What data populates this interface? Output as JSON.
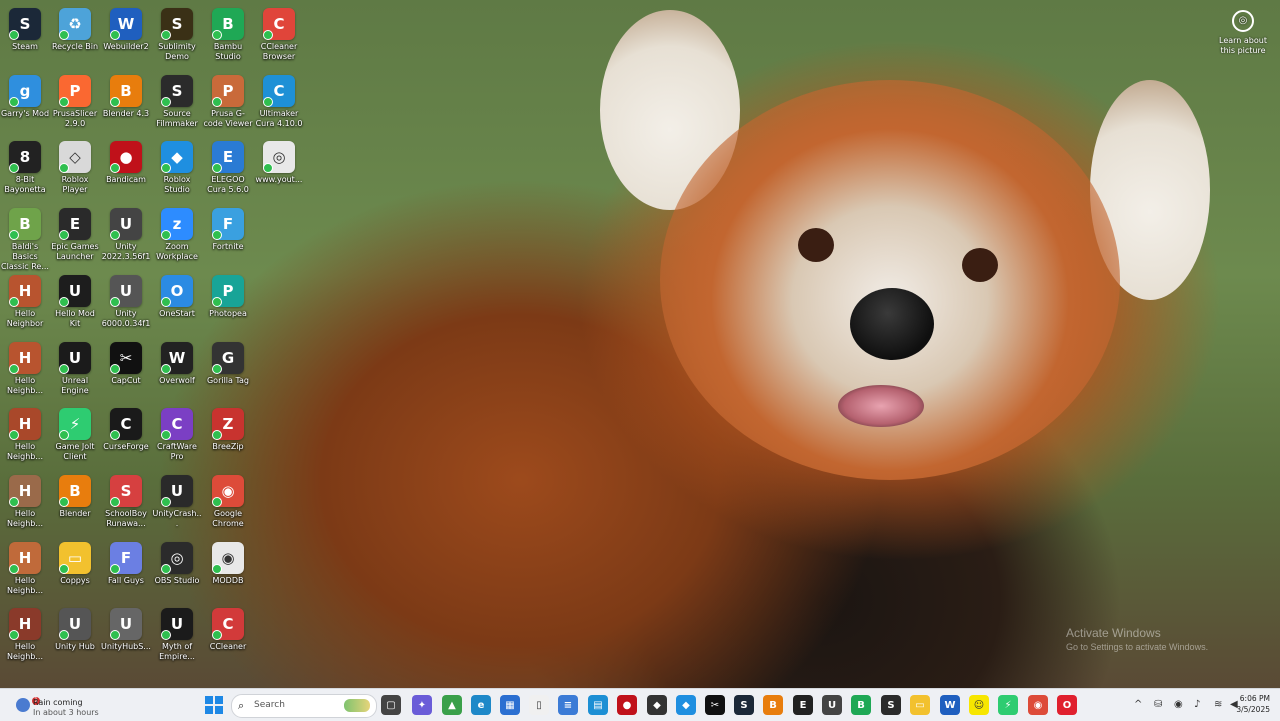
{
  "desktop": {
    "learn_more_label": "Learn about this picture",
    "watermark": {
      "line1": "Activate Windows",
      "line2": "Go to Settings to activate Windows."
    },
    "icons": [
      {
        "label": "Steam",
        "color": "#1b2838",
        "glyph": "S"
      },
      {
        "label": "Recycle Bin",
        "color": "#4da3d9",
        "glyph": "♻"
      },
      {
        "label": "Webuilder2",
        "color": "#1f5fbf",
        "glyph": "W"
      },
      {
        "label": "Sublimity Demo",
        "color": "#3a3016",
        "glyph": "S"
      },
      {
        "label": "Bambu Studio",
        "color": "#1fa855",
        "glyph": "B"
      },
      {
        "label": "CCleaner Browser",
        "color": "#e0453a",
        "glyph": "C"
      },
      {
        "label": "Garry's Mod",
        "color": "#2f8fde",
        "glyph": "g"
      },
      {
        "label": "PrusaSlicer 2.9.0",
        "color": "#fa6831",
        "glyph": "P"
      },
      {
        "label": "Blender 4.3",
        "color": "#e87d0d",
        "glyph": "B"
      },
      {
        "label": "Source Filmmaker",
        "color": "#2b2b2b",
        "glyph": "S"
      },
      {
        "label": "Prusa G-code Viewer",
        "color": "#c96a3a",
        "glyph": "P"
      },
      {
        "label": "Ultimaker Cura 4.10.0",
        "color": "#1e90d6",
        "glyph": "C"
      },
      {
        "label": "8-Bit Bayonetta",
        "color": "#222222",
        "glyph": "8"
      },
      {
        "label": "Roblox Player",
        "color": "#d9d9d9",
        "glyph": "◇"
      },
      {
        "label": "Bandicam",
        "color": "#c0111a",
        "glyph": "●"
      },
      {
        "label": "Roblox Studio",
        "color": "#1f8fe0",
        "glyph": "◆"
      },
      {
        "label": "ELEGOO Cura 5.6.0",
        "color": "#2a7bd4",
        "glyph": "E"
      },
      {
        "label": "www.yout...",
        "color": "#e8e8e8",
        "glyph": "◎"
      },
      {
        "label": "Baldi's Basics Classic Re...",
        "color": "#6fa34a",
        "glyph": "B"
      },
      {
        "label": "Epic Games Launcher",
        "color": "#2a2a2a",
        "glyph": "E"
      },
      {
        "label": "Unity 2022.3.56f1",
        "color": "#444444",
        "glyph": "U"
      },
      {
        "label": "Zoom Workplace",
        "color": "#2d8cff",
        "glyph": "z"
      },
      {
        "label": "Fortnite",
        "color": "#3aa0e0",
        "glyph": "F"
      },
      {
        "label": "",
        "color": "",
        "glyph": ""
      },
      {
        "label": "Hello Neighbor",
        "color": "#b8542f",
        "glyph": "H"
      },
      {
        "label": "Hello Mod Kit",
        "color": "#1d1d1d",
        "glyph": "U"
      },
      {
        "label": "Unity 6000.0.34f1",
        "color": "#555555",
        "glyph": "U"
      },
      {
        "label": "OneStart",
        "color": "#2b8be3",
        "glyph": "O"
      },
      {
        "label": "Photopea",
        "color": "#18a497",
        "glyph": "P"
      },
      {
        "label": "",
        "color": "",
        "glyph": ""
      },
      {
        "label": "Hello Neighb...",
        "color": "#b8542f",
        "glyph": "H"
      },
      {
        "label": "Unreal Engine",
        "color": "#1b1b1b",
        "glyph": "U"
      },
      {
        "label": "CapCut",
        "color": "#111111",
        "glyph": "✂"
      },
      {
        "label": "Overwolf",
        "color": "#222222",
        "glyph": "W"
      },
      {
        "label": "Gorilla Tag",
        "color": "#333333",
        "glyph": "G"
      },
      {
        "label": "",
        "color": "",
        "glyph": ""
      },
      {
        "label": "Hello Neighb...",
        "color": "#a9482a",
        "glyph": "H"
      },
      {
        "label": "Game Jolt Client",
        "color": "#2ecc71",
        "glyph": "⚡"
      },
      {
        "label": "CurseForge",
        "color": "#1a1a1a",
        "glyph": "C"
      },
      {
        "label": "CraftWare Pro",
        "color": "#7b3fc4",
        "glyph": "C"
      },
      {
        "label": "BreeZip",
        "color": "#c8332f",
        "glyph": "Z"
      },
      {
        "label": "",
        "color": "",
        "glyph": ""
      },
      {
        "label": "Hello Neighb...",
        "color": "#9a6a4a",
        "glyph": "H"
      },
      {
        "label": "Blender",
        "color": "#e87d0d",
        "glyph": "B"
      },
      {
        "label": "SchoolBoy Runawa...",
        "color": "#d64040",
        "glyph": "S"
      },
      {
        "label": "UnityCrash...",
        "color": "#2a2a2a",
        "glyph": "U"
      },
      {
        "label": "Google Chrome",
        "color": "#dd4b39",
        "glyph": "◉"
      },
      {
        "label": "",
        "color": "",
        "glyph": ""
      },
      {
        "label": "Hello Neighb...",
        "color": "#c06a3a",
        "glyph": "H"
      },
      {
        "label": "Coppys",
        "color": "#f2c12e",
        "glyph": "▭"
      },
      {
        "label": "Fall Guys",
        "color": "#6b7fe3",
        "glyph": "F"
      },
      {
        "label": "OBS Studio",
        "color": "#2b2b2b",
        "glyph": "◎"
      },
      {
        "label": "MODDB",
        "color": "#e8e8e8",
        "glyph": "◉"
      },
      {
        "label": "",
        "color": "",
        "glyph": ""
      },
      {
        "label": "Hello Neighb...",
        "color": "#8a3a2a",
        "glyph": "H"
      },
      {
        "label": "Unity Hub",
        "color": "#555555",
        "glyph": "U"
      },
      {
        "label": "UnityHubS...",
        "color": "#666666",
        "glyph": "U"
      },
      {
        "label": "Myth of Empire...",
        "color": "#1b1b1b",
        "glyph": "U"
      },
      {
        "label": "CCleaner",
        "color": "#d23a3a",
        "glyph": "C"
      },
      {
        "label": "",
        "color": "",
        "glyph": ""
      }
    ]
  },
  "taskbar": {
    "weather_line1": "Rain coming",
    "weather_line2": "In about 3 hours",
    "weather_badge": "1",
    "search_placeholder": "Search",
    "pinned": [
      {
        "name": "task-view",
        "color": "#444444",
        "glyph": "▢"
      },
      {
        "name": "copilot",
        "color": "#6a5cd8",
        "glyph": "✦"
      },
      {
        "name": "game-app",
        "color": "#3aa04a",
        "glyph": "▲"
      },
      {
        "name": "edge",
        "color": "#1e88c8",
        "glyph": "e"
      },
      {
        "name": "store",
        "color": "#2b6fd1",
        "glyph": "▦"
      },
      {
        "name": "notepad",
        "color": "#f0f0f0",
        "glyph": "▯"
      },
      {
        "name": "docs",
        "color": "#3b7bd6",
        "glyph": "≡"
      },
      {
        "name": "calendar",
        "color": "#1c8fd4",
        "glyph": "▤"
      },
      {
        "name": "record",
        "color": "#c0111a",
        "glyph": "●"
      },
      {
        "name": "roblox",
        "color": "#333333",
        "glyph": "◆"
      },
      {
        "name": "roblox-studio",
        "color": "#1f8fe0",
        "glyph": "◆"
      },
      {
        "name": "capcut",
        "color": "#111111",
        "glyph": "✂"
      },
      {
        "name": "steam",
        "color": "#1b2838",
        "glyph": "S"
      },
      {
        "name": "blender",
        "color": "#e87d0d",
        "glyph": "B"
      },
      {
        "name": "epic",
        "color": "#222222",
        "glyph": "E"
      },
      {
        "name": "unity",
        "color": "#444444",
        "glyph": "U"
      },
      {
        "name": "bambu",
        "color": "#1fa855",
        "glyph": "B"
      },
      {
        "name": "source-filmmaker",
        "color": "#2b2b2b",
        "glyph": "S"
      },
      {
        "name": "file-explorer",
        "color": "#f2c12e",
        "glyph": "▭"
      },
      {
        "name": "webuilder",
        "color": "#1f5fbf",
        "glyph": "W"
      },
      {
        "name": "snapchat",
        "color": "#f7e600",
        "glyph": "☺"
      },
      {
        "name": "game-jolt",
        "color": "#2ecc71",
        "glyph": "⚡"
      },
      {
        "name": "chrome",
        "color": "#dd4b39",
        "glyph": "◉"
      },
      {
        "name": "opera",
        "color": "#e0202e",
        "glyph": "O"
      }
    ],
    "tray": [
      {
        "name": "show-hidden-icons",
        "glyph": "^"
      },
      {
        "name": "network-app",
        "glyph": "⛁"
      },
      {
        "name": "shield",
        "glyph": "◉"
      },
      {
        "name": "microphone",
        "glyph": "♪"
      },
      {
        "name": "wifi",
        "glyph": "≋"
      },
      {
        "name": "volume",
        "glyph": "◀"
      }
    ],
    "time": "6:06 PM",
    "date": "3/5/2025"
  }
}
